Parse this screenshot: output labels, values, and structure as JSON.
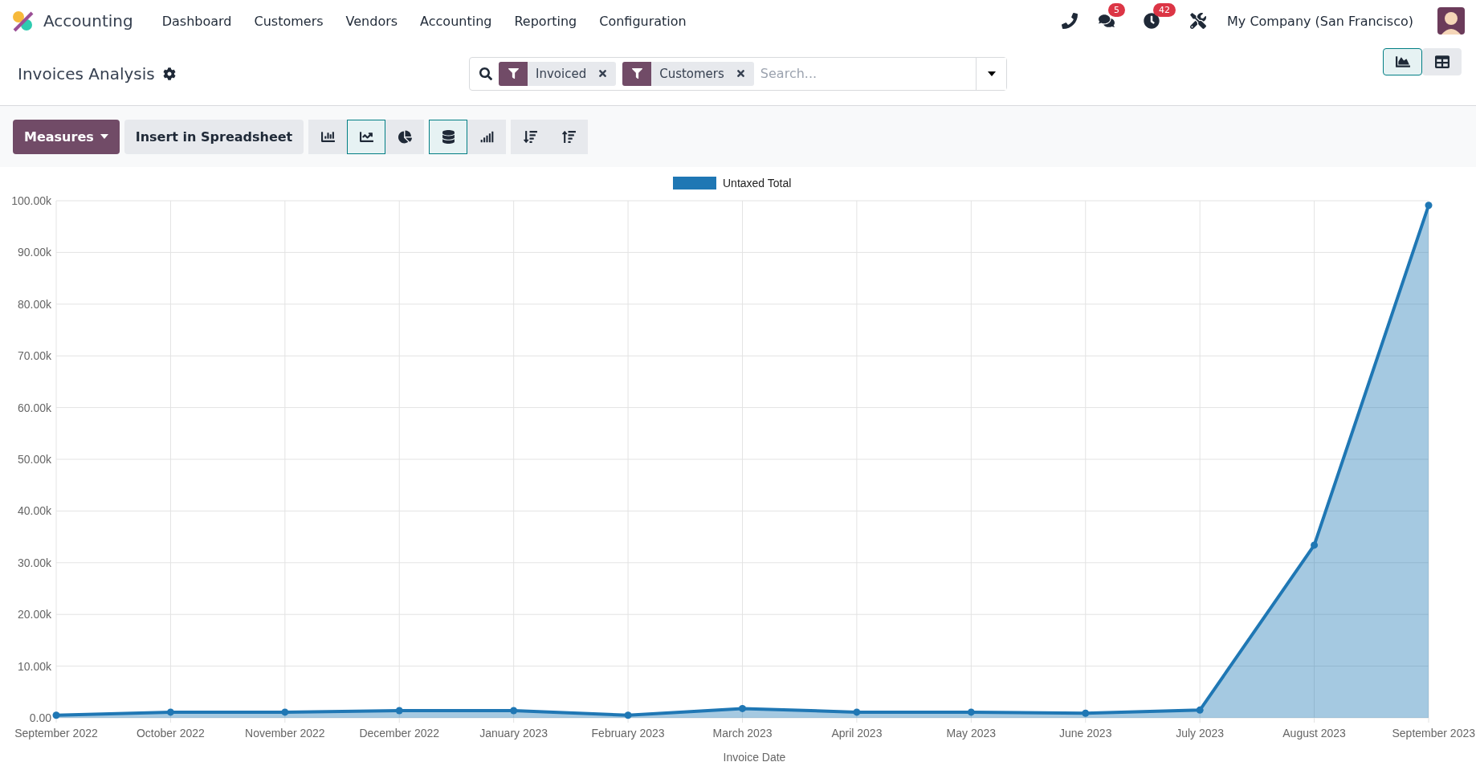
{
  "app": {
    "name": "Accounting"
  },
  "menu": [
    {
      "label": "Dashboard"
    },
    {
      "label": "Customers"
    },
    {
      "label": "Vendors"
    },
    {
      "label": "Accounting"
    },
    {
      "label": "Reporting"
    },
    {
      "label": "Configuration"
    }
  ],
  "systray": {
    "messages_count": "5",
    "activities_count": "42",
    "company": "My Company (San Francisco)"
  },
  "control_panel": {
    "title": "Invoices Analysis",
    "filters": [
      {
        "label": "Invoiced"
      },
      {
        "label": "Customers"
      }
    ],
    "search": {
      "placeholder": "Search..."
    },
    "views": [
      {
        "kind": "graph",
        "selected": true
      },
      {
        "kind": "pivot",
        "selected": false
      }
    ]
  },
  "toolbar": {
    "measures": "Measures",
    "insert": "Insert in Spreadsheet",
    "chart_types": [
      {
        "kind": "bar",
        "selected": false
      },
      {
        "kind": "line",
        "selected": true
      },
      {
        "kind": "pie",
        "selected": false
      }
    ],
    "options": [
      {
        "kind": "stacked",
        "selected": true
      },
      {
        "kind": "cumulative",
        "selected": false
      }
    ],
    "sort": [
      {
        "kind": "descending"
      },
      {
        "kind": "ascending"
      }
    ]
  },
  "chart_data": {
    "type": "area",
    "xlabel": "Invoice Date",
    "categories": [
      "September 2022",
      "October 2022",
      "November 2022",
      "December 2022",
      "January 2023",
      "February 2023",
      "March 2023",
      "April 2023",
      "May 2023",
      "June 2023",
      "July 2023",
      "August 2023",
      "September 2023"
    ],
    "series": [
      {
        "name": "Untaxed Total",
        "color": "#1f77b4",
        "values": [
          500,
          1100,
          1100,
          1400,
          1400,
          500,
          1800,
          1100,
          1100,
          900,
          1500,
          33400,
          99100
        ]
      }
    ],
    "ylim": [
      0,
      100000
    ],
    "grid": true,
    "yticks": [
      {
        "value": 0,
        "label": "0.00"
      },
      {
        "value": 10000,
        "label": "10.00k"
      },
      {
        "value": 20000,
        "label": "20.00k"
      },
      {
        "value": 30000,
        "label": "30.00k"
      },
      {
        "value": 40000,
        "label": "40.00k"
      },
      {
        "value": 50000,
        "label": "50.00k"
      },
      {
        "value": 60000,
        "label": "60.00k"
      },
      {
        "value": 70000,
        "label": "70.00k"
      },
      {
        "value": 80000,
        "label": "80.00k"
      },
      {
        "value": 90000,
        "label": "90.00k"
      },
      {
        "value": 100000,
        "label": "100.00k"
      }
    ]
  }
}
